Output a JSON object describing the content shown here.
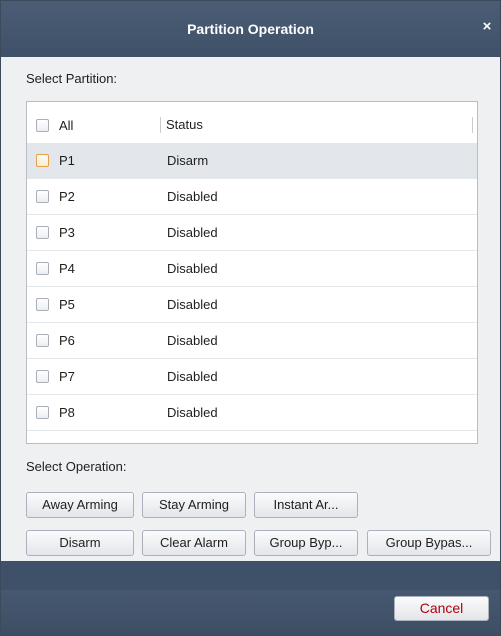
{
  "dialog": {
    "title": "Partition Operation",
    "close_glyph": "×"
  },
  "select_partition_label": "Select Partition:",
  "table": {
    "header": {
      "all_label": "All",
      "status_label": "Status"
    },
    "rows": [
      {
        "name": "P1",
        "status": "Disarm",
        "selected": true
      },
      {
        "name": "P2",
        "status": "Disabled",
        "selected": false
      },
      {
        "name": "P3",
        "status": "Disabled",
        "selected": false
      },
      {
        "name": "P4",
        "status": "Disabled",
        "selected": false
      },
      {
        "name": "P5",
        "status": "Disabled",
        "selected": false
      },
      {
        "name": "P6",
        "status": "Disabled",
        "selected": false
      },
      {
        "name": "P7",
        "status": "Disabled",
        "selected": false
      },
      {
        "name": "P8",
        "status": "Disabled",
        "selected": false
      }
    ]
  },
  "select_operation_label": "Select Operation:",
  "operations": {
    "away_arming": "Away Arming",
    "stay_arming": "Stay Arming",
    "instant_arming": "Instant Ar...",
    "disarm": "Disarm",
    "clear_alarm": "Clear Alarm",
    "group_bypass": "Group Byp...",
    "group_bypass_recover": "Group Bypas..."
  },
  "footer": {
    "cancel_label": "Cancel"
  },
  "colors": {
    "titlebar": "#44566d",
    "footer": "#3f5168",
    "dialog_bg": "#eef0f2",
    "selected_row": "#e3e6ea",
    "cancel_text": "#b00010",
    "checkbox_highlight": "#e0a24a"
  }
}
